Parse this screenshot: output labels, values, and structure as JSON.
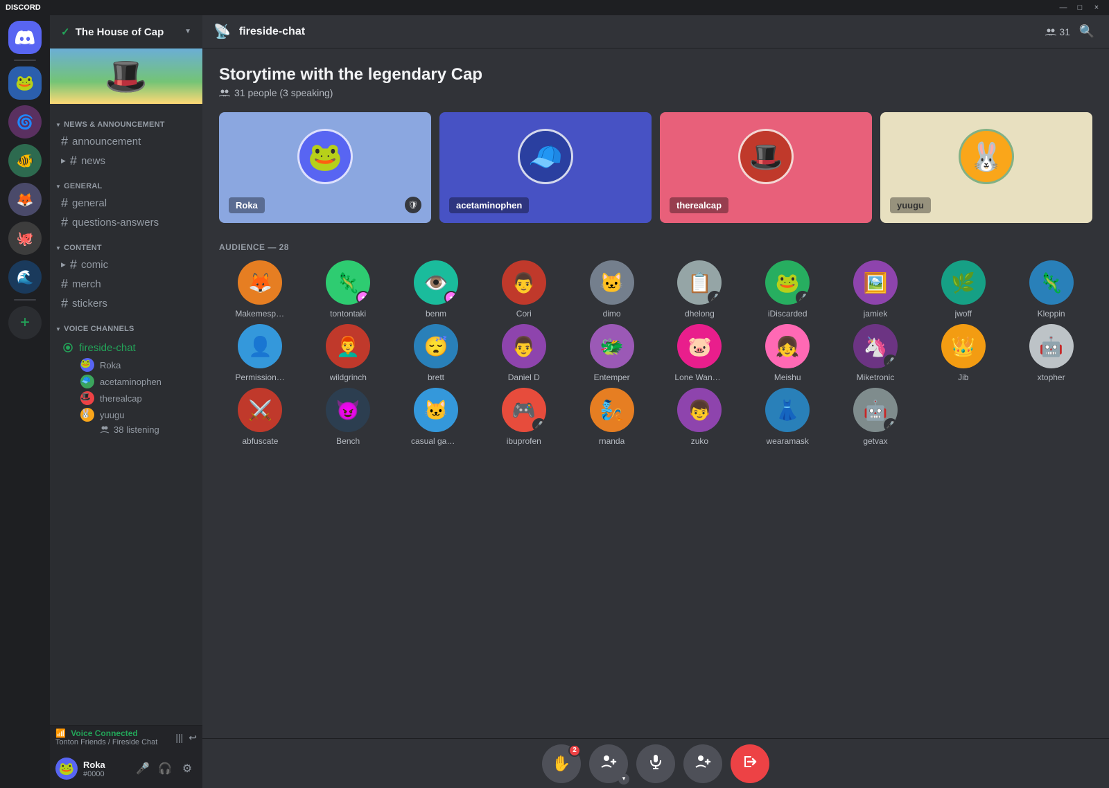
{
  "titleBar": {
    "appName": "DISCORD",
    "controls": [
      "—",
      "□",
      "×"
    ]
  },
  "serverList": {
    "servers": [
      {
        "id": "discord-home",
        "label": "Discord Home",
        "icon": "discord"
      },
      {
        "id": "server-1",
        "label": "Server 1",
        "color": "#5865f2"
      },
      {
        "id": "server-2",
        "label": "Server 2",
        "color": "#3ba55d"
      },
      {
        "id": "server-3",
        "label": "Server 3",
        "color": "#ed4245"
      },
      {
        "id": "server-4",
        "label": "Server 4",
        "color": "#faa61a"
      },
      {
        "id": "server-5",
        "label": "Server 5",
        "color": "#9c84ef"
      },
      {
        "id": "server-6",
        "label": "Server 6",
        "color": "#1abc9c"
      },
      {
        "id": "server-7",
        "label": "Server 7",
        "color": "#e67e22"
      }
    ]
  },
  "sidebar": {
    "serverName": "The House of Cap",
    "checkmark": "✓",
    "chevron": "▼",
    "categories": [
      {
        "name": "NEWS & ANNOUNCEMENT",
        "channels": [
          {
            "name": "announcement",
            "type": "hash"
          },
          {
            "name": "news",
            "type": "hash",
            "collapsed": true
          }
        ]
      },
      {
        "name": "GENERAL",
        "channels": [
          {
            "name": "general",
            "type": "hash"
          },
          {
            "name": "questions-answers",
            "type": "hash"
          }
        ]
      },
      {
        "name": "CONTENT",
        "channels": [
          {
            "name": "comic",
            "type": "hash",
            "collapsed": true
          },
          {
            "name": "merch",
            "type": "hash"
          },
          {
            "name": "stickers",
            "type": "hash"
          }
        ]
      }
    ],
    "voiceChannels": {
      "categoryName": "VOICE CHANNELS",
      "channels": [
        {
          "name": "fireside-chat",
          "active": true,
          "subtitle": "Storytime with the legendary Cap",
          "speakers": [
            {
              "name": "Roka",
              "color": "#5865f2"
            },
            {
              "name": "acetaminophen",
              "color": "#3ba55d"
            },
            {
              "name": "therealcap",
              "color": "#ed4245"
            },
            {
              "name": "yuugu",
              "color": "#faa61a"
            }
          ],
          "listeningCount": "38 listening"
        }
      ]
    }
  },
  "voiceConnected": {
    "status": "Voice Connected",
    "server": "Tonton Friends / Fireside Chat"
  },
  "userArea": {
    "username": "Roka",
    "discriminator": "#0000"
  },
  "channelHeader": {
    "icon": "📡",
    "name": "fireside-chat",
    "memberCount": "31"
  },
  "stage": {
    "title": "Storytime with the legendary Cap",
    "subtitle": "31 people (3 speaking)",
    "speakers": [
      {
        "name": "Roka",
        "cardColor": "card-blue",
        "emoji": "🐸",
        "hasShield": true
      },
      {
        "name": "acetaminophen",
        "cardColor": "card-deep-blue",
        "emoji": "🧢"
      },
      {
        "name": "therealcap",
        "cardColor": "card-pink",
        "emoji": "🎩"
      },
      {
        "name": "yuugu",
        "cardColor": "card-cream",
        "emoji": "🐰"
      }
    ],
    "audienceLabel": "AUDIENCE — 28",
    "audience": [
      {
        "name": "Makemespeakrr",
        "emoji": "🦊",
        "color": "#e67e22"
      },
      {
        "name": "tontontaki",
        "emoji": "🦎",
        "color": "#2ecc71",
        "badge": "boost"
      },
      {
        "name": "benm",
        "emoji": "👁️",
        "color": "#1abc9c",
        "badge": "boost"
      },
      {
        "name": "Cori",
        "emoji": "👨",
        "color": "#e74c3c"
      },
      {
        "name": "dimo",
        "emoji": "🐱",
        "color": "#747f8d"
      },
      {
        "name": "dhelong",
        "emoji": "📋",
        "color": "#95a5a6",
        "badge": "mic"
      },
      {
        "name": "iDiscarded",
        "emoji": "🐸",
        "color": "#27ae60",
        "badge": "mic"
      },
      {
        "name": "jamiek",
        "emoji": "🖼️",
        "color": "#8e44ad"
      },
      {
        "name": "jwoff",
        "emoji": "🌿",
        "color": "#16a085"
      },
      {
        "name": "Kleppin",
        "emoji": "🦎",
        "color": "#2980b9"
      },
      {
        "name": "Permission Man",
        "emoji": "👤",
        "color": "#3498db"
      },
      {
        "name": "wildgrinch",
        "emoji": "👨‍🦰",
        "color": "#c0392b"
      },
      {
        "name": "brett",
        "emoji": "😴",
        "color": "#2980b9"
      },
      {
        "name": "Daniel D",
        "emoji": "👨",
        "color": "#8e44ad"
      },
      {
        "name": "Entemper",
        "emoji": "🐲",
        "color": "#9b59b6"
      },
      {
        "name": "Lone Wanderer",
        "emoji": "🐷",
        "color": "#e91e8c"
      },
      {
        "name": "Meishu",
        "emoji": "👧",
        "color": "#ff69b4"
      },
      {
        "name": "Miketronic",
        "emoji": "🦄",
        "color": "#6c3483",
        "badge": "mic"
      },
      {
        "name": "Jib",
        "emoji": "👑",
        "color": "#f39c12"
      },
      {
        "name": "xtopher",
        "emoji": "🤖",
        "color": "#bdc3c7"
      },
      {
        "name": "abfuscate",
        "emoji": "⚔️",
        "color": "#c0392b"
      },
      {
        "name": "Bench",
        "emoji": "😈",
        "color": "#2c3e50"
      },
      {
        "name": "casual gamer",
        "emoji": "🐱",
        "color": "#3498db"
      },
      {
        "name": "ibuprofen",
        "emoji": "🎮",
        "color": "#e74c3c",
        "badge": "mic"
      },
      {
        "name": "rnanda",
        "emoji": "🧞",
        "color": "#e67e22"
      },
      {
        "name": "zuko",
        "emoji": "👦",
        "color": "#8e44ad"
      },
      {
        "name": "wearamask",
        "emoji": "👗",
        "color": "#2980b9"
      },
      {
        "name": "getvax",
        "emoji": "🤖",
        "color": "#7f8c8d",
        "badge": "mic"
      }
    ]
  },
  "toolbar": {
    "buttons": [
      {
        "name": "raise-hand",
        "icon": "✋",
        "badge": "2"
      },
      {
        "name": "invite",
        "icon": "👥",
        "hasChevron": true
      },
      {
        "name": "mute",
        "icon": "🎤"
      },
      {
        "name": "add-member",
        "icon": "👤+"
      },
      {
        "name": "leave",
        "icon": "→",
        "danger": true
      }
    ]
  }
}
